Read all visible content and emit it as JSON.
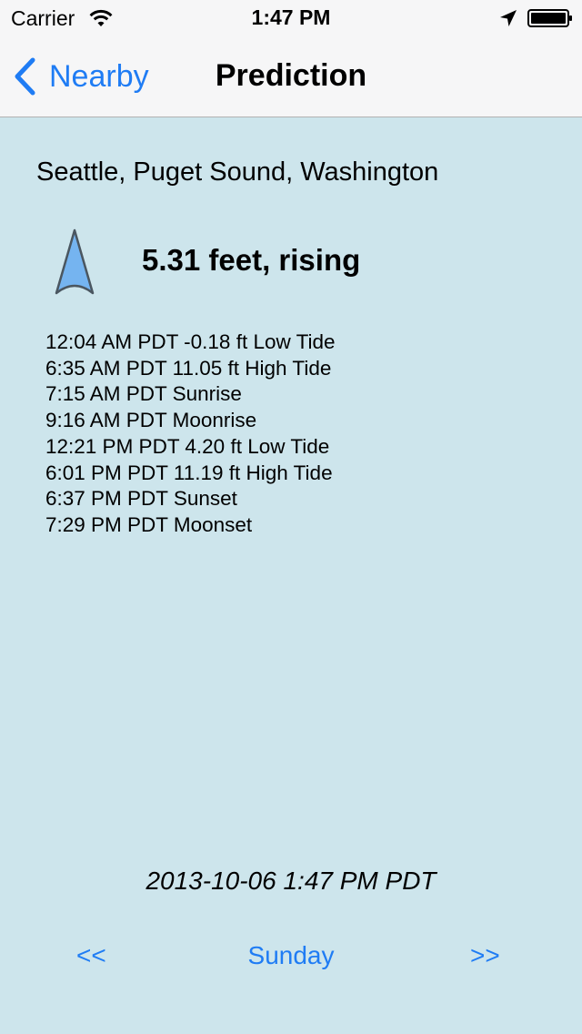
{
  "status_bar": {
    "carrier": "Carrier",
    "time": "1:47 PM",
    "icons": [
      "wifi-icon",
      "location-arrow-icon",
      "battery-icon"
    ]
  },
  "nav": {
    "back_label": "Nearby",
    "title": "Prediction"
  },
  "station": "Seattle, Puget Sound, Washington",
  "current": {
    "level": "5.31 feet, rising",
    "icon": "rising-tide-arrow-icon",
    "arrow_color": "#75b4f0"
  },
  "events": [
    "12:04 AM PDT -0.18 ft Low Tide",
    "6:35 AM PDT 11.05 ft High Tide",
    "7:15 AM PDT Sunrise",
    "9:16 AM PDT Moonrise",
    "12:21 PM PDT 4.20 ft Low Tide",
    "6:01 PM PDT 11.19 ft High Tide",
    "6:37 PM PDT Sunset",
    "7:29 PM PDT Moonset"
  ],
  "timestamp": "2013-10-06  1:47 PM PDT",
  "day_nav": {
    "prev": "<<",
    "day": "Sunday",
    "next": ">>"
  },
  "colors": {
    "accent": "#1f7cf4",
    "background": "#cde5ec",
    "bar": "#f6f6f7"
  }
}
